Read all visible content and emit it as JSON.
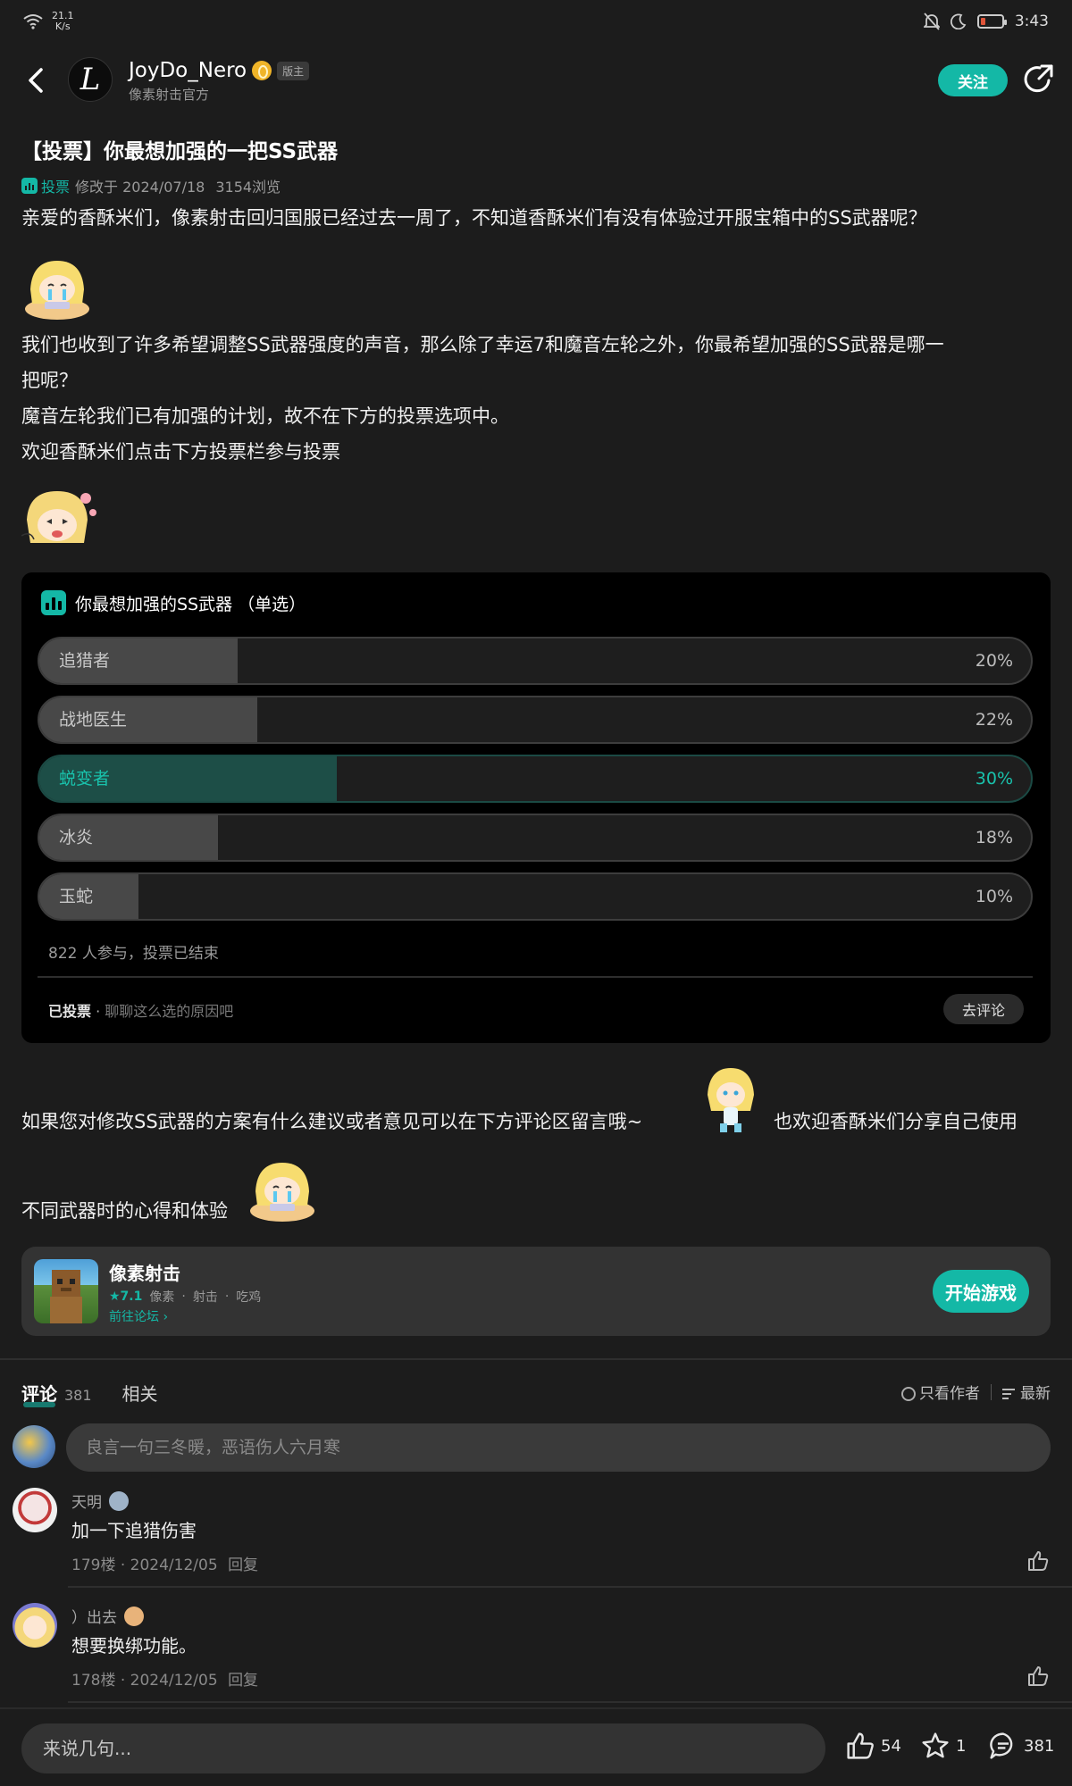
{
  "status_bar": {
    "net_speed": "21.1",
    "net_unit": "K/s",
    "time": "3:43"
  },
  "header": {
    "author_name": "JoyDo_Nero",
    "author_badge": "版主",
    "author_subtitle": "像素射击官方",
    "avatar_letter": "L",
    "follow_label": "关注"
  },
  "post": {
    "title": "【投票】你最想加强的一把SS武器",
    "tag": "投票",
    "modified": "修改于 2024/07/18",
    "views": "3154浏览",
    "p1": "亲爱的香酥米们，像素射击回归国服已经过去一周了，不知道香酥米们有没有体验过开服宝箱中的SS武器呢？",
    "p2a": "我们也收到了许多希望调整SS武器强度的声音，那么除了幸运7和魔音左轮之外，你最希望加强的SS武器是哪一",
    "p2b": "把呢？",
    "p3": "魔音左轮我们已有加强的计划，故不在下方的投票选项中。",
    "p4": "欢迎香酥米们点击下方投票栏参与投票",
    "p5a": "如果您对修改SS武器的方案有什么建议或者意见可以在下方评论区留言哦~",
    "p5b": "也欢迎香酥米们分享自己使用",
    "p6": "不同武器时的心得和体验"
  },
  "poll": {
    "title": "你最想加强的SS武器 （单选）",
    "options": [
      {
        "label": "追猎者",
        "pct_text": "20%",
        "fraction": 0.2
      },
      {
        "label": "战地医生",
        "pct_text": "22%",
        "fraction": 0.22
      },
      {
        "label": "蜕变者",
        "pct_text": "30%",
        "fraction": 0.3
      },
      {
        "label": "冰炎",
        "pct_text": "18%",
        "fraction": 0.18
      },
      {
        "label": "玉蛇",
        "pct_text": "10%",
        "fraction": 0.1
      }
    ],
    "stats": "822 人参与，投票已结束",
    "voted_label": "已投票",
    "voted_hint": "聊聊这么选的原因吧",
    "comment_button": "去评论"
  },
  "game": {
    "name": "像素射击",
    "rating": "★7.1",
    "genres": [
      "像素",
      "射击",
      "吃鸡"
    ],
    "forum_link": "前往论坛",
    "play_button": "开始游戏"
  },
  "comments_section": {
    "tab_comments": "评论",
    "comment_count": "381",
    "tab_related": "相关",
    "filter_author": "只看作者",
    "filter_latest": "最新",
    "input_placeholder": "良言一句三冬暖，恶语伤人六月寒",
    "items": [
      {
        "user": "天明",
        "text": "加一下追猎伤害",
        "floor": "179楼",
        "date": "2024/12/05",
        "reply": "回复"
      },
      {
        "user": "）出去",
        "text": "想要换绑功能。",
        "floor": "178楼",
        "date": "2024/12/05",
        "reply": "回复"
      }
    ]
  },
  "bottom_bar": {
    "placeholder": "来说几句...",
    "likes": "54",
    "favorites": "1",
    "comments": "381"
  },
  "colors": {
    "accent": "#14b8a6",
    "background": "#1c1c1c",
    "poll_bg": "#000000"
  },
  "icons": [
    "wifi-icon",
    "mute-icon",
    "moon-icon",
    "battery-icon",
    "back-icon",
    "share-icon",
    "vote-icon",
    "like-icon",
    "star-icon",
    "comment-icon",
    "list-icon"
  ]
}
